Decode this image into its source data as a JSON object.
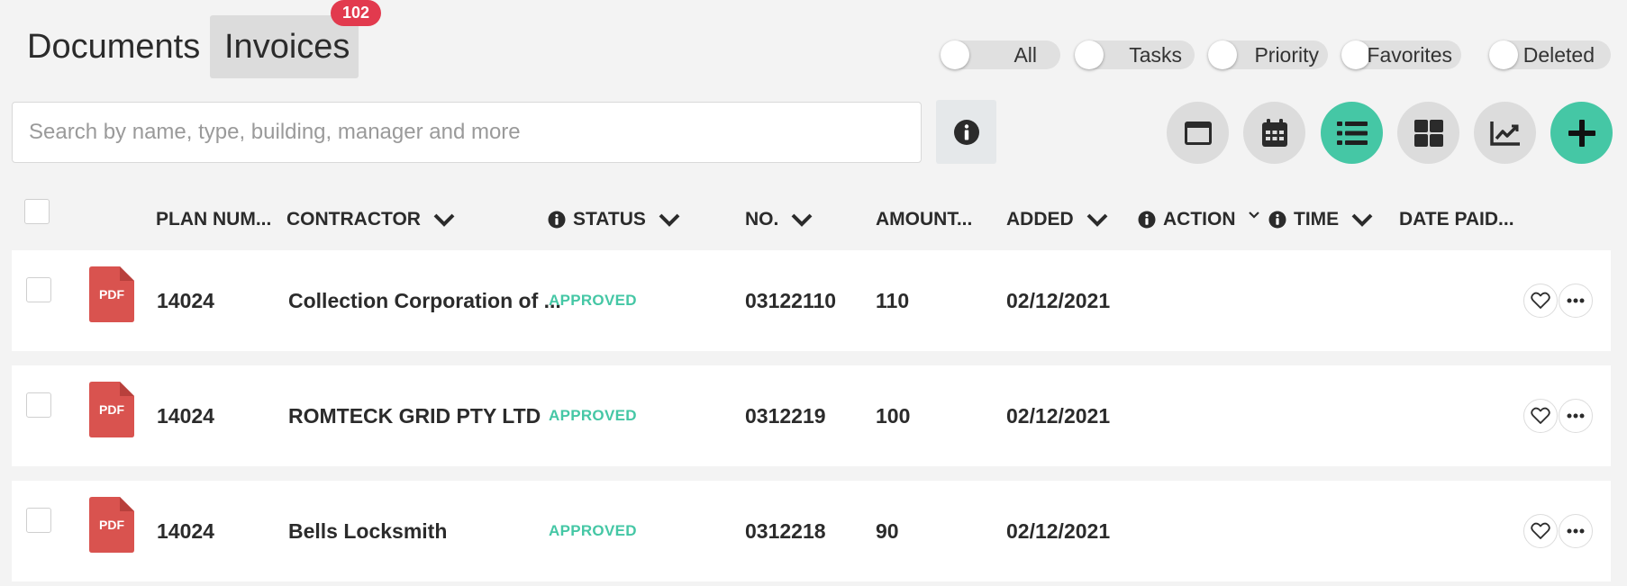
{
  "tabs": [
    {
      "label": "Documents"
    },
    {
      "label": "Invoices",
      "badge": "102"
    }
  ],
  "filters": [
    {
      "label": "All"
    },
    {
      "label": "Tasks"
    },
    {
      "label": "Priority"
    },
    {
      "label": "Favorites"
    },
    {
      "label": "Deleted"
    }
  ],
  "search": {
    "placeholder": "Search by name, type, building, manager and more",
    "value": ""
  },
  "view_buttons": [
    {
      "icon": "card-view-icon"
    },
    {
      "icon": "calendar-icon"
    },
    {
      "icon": "list-view-icon",
      "active": true
    },
    {
      "icon": "grid-view-icon"
    },
    {
      "icon": "chart-icon"
    },
    {
      "icon": "plus-icon",
      "active": true
    }
  ],
  "columns": {
    "plan_num": "PLAN NUM...",
    "contractor": "CONTRACTOR",
    "status": "STATUS",
    "no": "NO.",
    "amount": "AMOUNT...",
    "added": "ADDED",
    "action": "ACTION",
    "time": "TIME",
    "date_paid": "DATE PAID..."
  },
  "rows": [
    {
      "file_type": "PDF",
      "plan_num": "14024",
      "contractor": "Collection Corporation of ...",
      "status": "APPROVED",
      "no": "03122110",
      "amount": "110",
      "added": "02/12/2021"
    },
    {
      "file_type": "PDF",
      "plan_num": "14024",
      "contractor": "ROMTECK GRID PTY LTD",
      "status": "APPROVED",
      "no": "0312219",
      "amount": "100",
      "added": "02/12/2021"
    },
    {
      "file_type": "PDF",
      "plan_num": "14024",
      "contractor": "Bells Locksmith",
      "status": "APPROVED",
      "no": "0312218",
      "amount": "90",
      "added": "02/12/2021"
    }
  ],
  "colors": {
    "accent": "#45c7a5",
    "badge": "#e23a4e",
    "pdf": "#d9534f",
    "status": "#45c7a5"
  }
}
